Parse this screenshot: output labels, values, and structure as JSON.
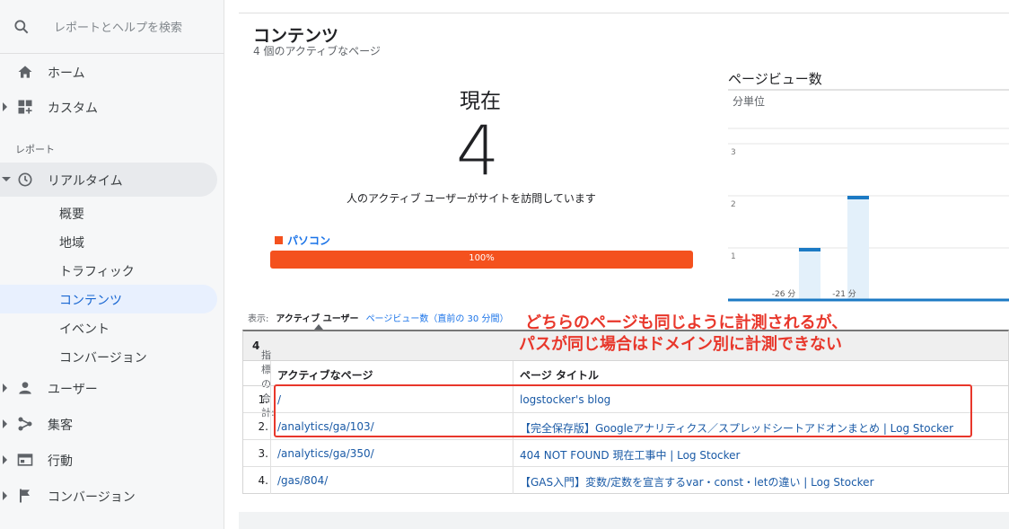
{
  "sidebar": {
    "search_placeholder": "レポートとヘルプを検索",
    "home": "ホーム",
    "custom": "カスタム",
    "section_reports": "レポート",
    "realtime": "リアルタイム",
    "realtime_sub": [
      "概要",
      "地域",
      "トラフィック",
      "コンテンツ",
      "イベント",
      "コンバージョン"
    ],
    "users": "ユーザー",
    "acquisition": "集客",
    "behavior": "行動",
    "conversions": "コンバージョン"
  },
  "main": {
    "title": "コンテンツ",
    "subtitle": "4 個のアクティブなページ",
    "now_label": "現在",
    "now_number": "4",
    "now_desc": "人のアクティブ ユーザーがサイトを訪問しています",
    "device_label": "パソコン",
    "device_percent": "100%",
    "device_fraction": 1.0,
    "device_color": "#f4511e",
    "pageviews_title": "ページビュー数",
    "pageviews_unit": "分単位"
  },
  "chart_data": {
    "type": "bar",
    "y_ticks": [
      "3",
      "2",
      "1"
    ],
    "x_tick_labels": [
      "-26 分",
      "-21 分"
    ],
    "ylim": [
      0,
      3.5
    ],
    "bars": [
      {
        "minute": -24,
        "value": 1
      },
      {
        "minute": -20,
        "value": 2
      }
    ]
  },
  "display_row": {
    "label": "表示:",
    "active_users": "アクティブ ユーザー",
    "pageviews_link": "ページビュー数（直前の 30 分間）"
  },
  "table": {
    "total_label": "指標の合計:",
    "total_value": "4",
    "col_page": "アクティブなページ",
    "col_title": "ページ タイトル",
    "rows": [
      {
        "num": "1.",
        "path": "/",
        "title": "logstocker's blog"
      },
      {
        "num": "2.",
        "path": "/analytics/ga/103/",
        "title": "【完全保存版】Googleアナリティクス／スプレッドシートアドオンまとめ | Log Stocker"
      },
      {
        "num": "3.",
        "path": "/analytics/ga/350/",
        "title": "404 NOT FOUND 現在工事中 | Log Stocker"
      },
      {
        "num": "4.",
        "path": "/gas/804/",
        "title": "【GAS入門】変数/定数を宣言するvar・const・letの違い | Log Stocker"
      }
    ]
  },
  "annotation": {
    "line1": "どちらのページも同じように計測されるが、",
    "line2": "パスが同じ場合はドメイン別に計測できない",
    "color": "#e8372b"
  }
}
